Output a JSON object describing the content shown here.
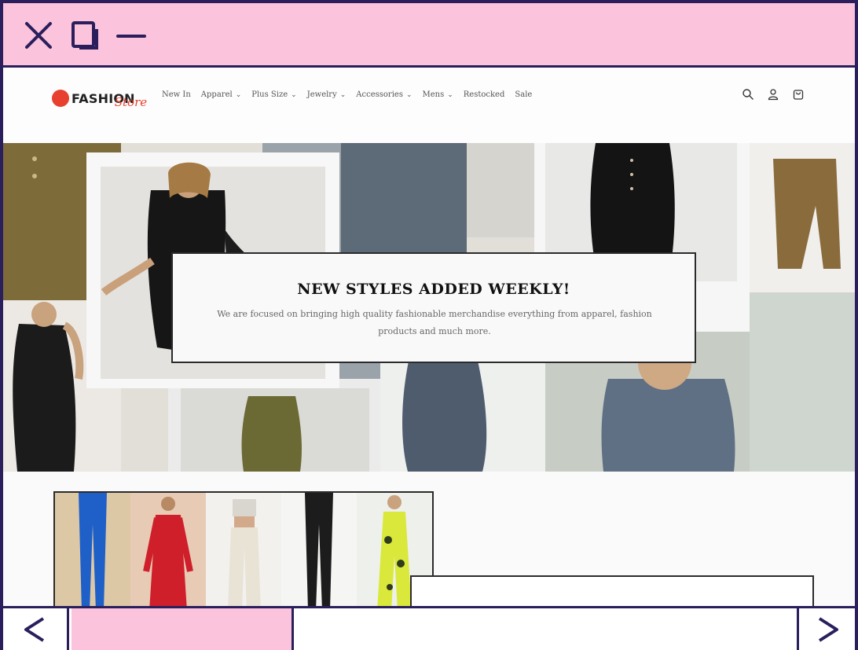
{
  "window": {
    "controls": [
      "close-icon",
      "maximize-icon",
      "minimize-icon"
    ],
    "accent": "#fbc3dc",
    "border": "#2a1f5c"
  },
  "header": {
    "logo_word": "FASHION",
    "logo_script": "Store",
    "logo_color": "#e8402e",
    "nav": [
      {
        "label": "New In",
        "dropdown": false
      },
      {
        "label": "Apparel",
        "dropdown": true
      },
      {
        "label": "Plus Size",
        "dropdown": true
      },
      {
        "label": "Jewelry",
        "dropdown": true
      },
      {
        "label": "Accessories",
        "dropdown": true
      },
      {
        "label": "Mens",
        "dropdown": true
      },
      {
        "label": "Restocked",
        "dropdown": false
      },
      {
        "label": "Sale",
        "dropdown": false
      }
    ],
    "icons": [
      "search-icon",
      "account-icon",
      "cart-icon"
    ]
  },
  "hero": {
    "title": "NEW STYLES ADDED WEEKLY!",
    "text": "We are focused on bringing high quality fashionable merchandise everything from apparel, fashion products and much more."
  },
  "products": {
    "items": [
      {
        "garment": "blue wide-leg pants",
        "color": "#1f5fc8"
      },
      {
        "garment": "red long-sleeve dress",
        "color": "#cf1f2a"
      },
      {
        "garment": "cream pants with crop top",
        "color": "#e9e3d6"
      },
      {
        "garment": "black leggings",
        "color": "#1c1c1c"
      },
      {
        "garment": "yellow floral jumpsuit",
        "color": "#d9e83b"
      }
    ]
  },
  "scrollbar": {
    "prev_icon": "chevron-left-icon",
    "next_icon": "chevron-right-icon",
    "position": 0.09
  }
}
